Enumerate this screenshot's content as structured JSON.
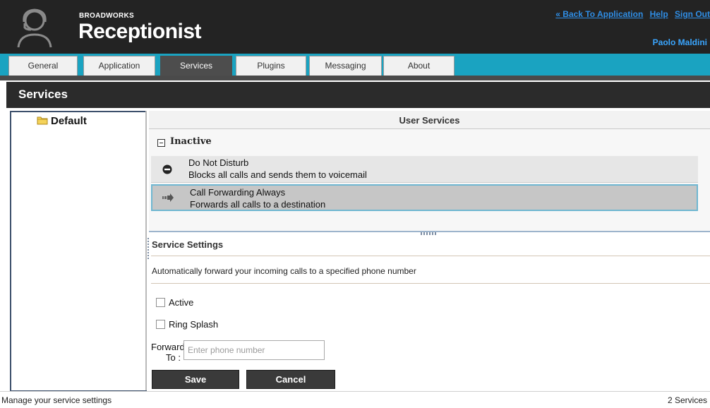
{
  "header": {
    "brand_small": "BROADWORKS",
    "brand_big": "Receptionist",
    "links": {
      "back": "« Back To Application",
      "help": "Help",
      "signout": "Sign Out"
    },
    "user": "Paolo Maldini"
  },
  "tabs": [
    {
      "label": "General"
    },
    {
      "label": "Application"
    },
    {
      "label": "Services",
      "active": true
    },
    {
      "label": "Plugins"
    },
    {
      "label": "Messaging"
    },
    {
      "label": "About"
    }
  ],
  "page_title": "Services",
  "left_panel": {
    "folder": "Default"
  },
  "user_services": {
    "title": "User Services",
    "group": "Inactive",
    "items": [
      {
        "name": "Do Not Disturb",
        "description": "Blocks all calls and sends them to voicemail",
        "icon": "do-not-disturb-icon"
      },
      {
        "name": "Call Forwarding Always",
        "description": "Forwards all calls to a destination",
        "icon": "forward-arrow-icon",
        "selected": true
      }
    ]
  },
  "service_settings": {
    "title": "Service Settings",
    "description": "Automatically forward your incoming calls to a specified phone number",
    "active_label": "Active",
    "ring_splash_label": "Ring Splash",
    "forward_to_label": "Forward To :",
    "phone_placeholder": "Enter phone number",
    "save": "Save",
    "cancel": "Cancel"
  },
  "status": {
    "left": "Manage your service settings",
    "right": "2 Services"
  },
  "colors": {
    "tabbar": "#1aa3c1",
    "link": "#2f8ee6",
    "selected_border": "#6fb7d1"
  }
}
